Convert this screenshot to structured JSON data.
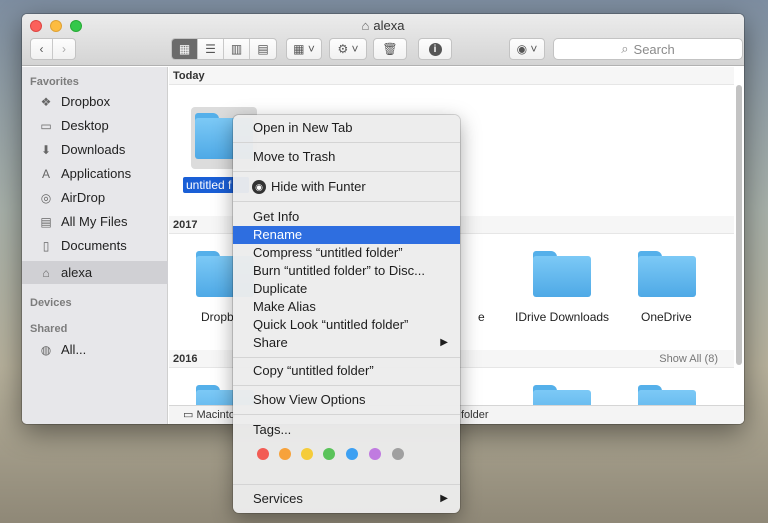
{
  "window": {
    "title": "alexa"
  },
  "toolbar": {
    "search_placeholder": "Search"
  },
  "sidebar": {
    "favorites_header": "Favorites",
    "items": [
      {
        "label": "Dropbox",
        "icon": "dropbox-icon"
      },
      {
        "label": "Desktop",
        "icon": "desktop-icon"
      },
      {
        "label": "Downloads",
        "icon": "downloads-icon"
      },
      {
        "label": "Applications",
        "icon": "applications-icon"
      },
      {
        "label": "AirDrop",
        "icon": "airdrop-icon"
      },
      {
        "label": "All My Files",
        "icon": "all-files-icon"
      },
      {
        "label": "Documents",
        "icon": "documents-icon"
      },
      {
        "label": "alexa",
        "icon": "home-icon"
      }
    ],
    "devices_header": "Devices",
    "shared_header": "Shared",
    "shared_items": [
      {
        "label": "All...",
        "icon": "network-icon"
      }
    ]
  },
  "content": {
    "sections": [
      {
        "label": "Today"
      },
      {
        "label": "2017"
      },
      {
        "label": "2016",
        "show_all": "Show All (8)"
      }
    ],
    "today_items": [
      {
        "label": "untitled f"
      }
    ],
    "items_2017": [
      {
        "label": "Dropb"
      },
      {
        "label": "e"
      },
      {
        "label": "IDrive Downloads"
      },
      {
        "label": "OneDrive"
      }
    ],
    "pathbar": {
      "left": "Macinto",
      "right": "folder"
    }
  },
  "context_menu": {
    "items": [
      "Open in New Tab",
      "Move to Trash",
      "Hide with Funter",
      "Get Info",
      "Rename",
      "Compress “untitled folder”",
      "Burn “untitled folder” to Disc...",
      "Duplicate",
      "Make Alias",
      "Quick Look “untitled folder”",
      "Share",
      "Copy “untitled folder”",
      "Show View Options",
      "Tags...",
      "Services"
    ],
    "highlighted": "Rename",
    "tag_colors": [
      "#f25c54",
      "#f7a23b",
      "#f5cc3a",
      "#5ac35a",
      "#3da0f2",
      "#c07be0",
      "#a0a0a0"
    ]
  }
}
